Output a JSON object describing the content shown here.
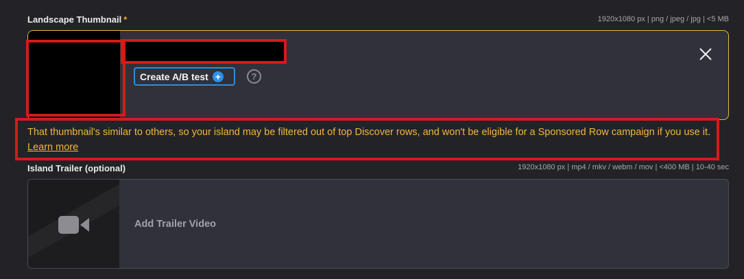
{
  "thumbnail_section": {
    "label": "Landscape Thumbnail",
    "required_mark": "*",
    "spec": "1920x1080 px | png / jpeg / jpg | <5 MB",
    "ab_test_label": "Create A/B test",
    "help_glyph": "?",
    "plus_glyph": "+"
  },
  "warning": {
    "text": "That thumbnail's similar to others, so your island may be filtered out of top Discover rows, and won't be eligible for a Sponsored Row campaign if you use it.",
    "link_label": "Learn more"
  },
  "trailer_section": {
    "label": "Island Trailer (optional)",
    "spec": "1920x1080 px | mp4 / mkv / webm / mov | <400 MB | 10-40 sec",
    "add_label": "Add Trailer Video"
  },
  "colors": {
    "background": "#232327",
    "card": "#30313a",
    "accent_border": "#e7b93f",
    "warning_text": "#f2b73c",
    "button_border": "#2d8ee0",
    "highlight_red": "#d61a1a"
  },
  "icons": [
    "plus-icon",
    "help-icon",
    "close-icon",
    "video-camera-icon"
  ]
}
